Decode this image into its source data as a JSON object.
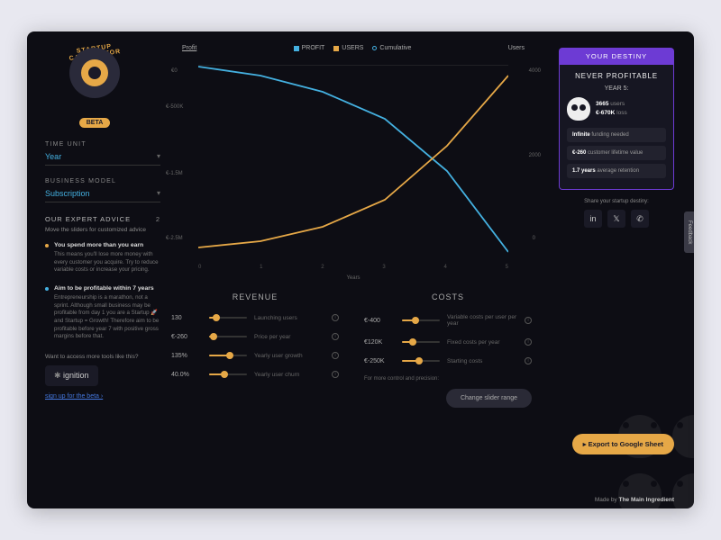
{
  "logo": {
    "title": "STARTUP CALCULATOR",
    "badge": "BETA"
  },
  "sidebar": {
    "time_unit_label": "TIME UNIT",
    "time_unit_value": "Year",
    "model_label": "BUSINESS MODEL",
    "model_value": "Subscription",
    "advice_header": "OUR EXPERT ADVICE",
    "advice_count": "2",
    "advice_sub": "Move the sliders for customized advice",
    "advice": [
      {
        "title": "You spend more than you earn",
        "body": "This means you'll lose more money with every customer you acquire. Try to reduce variable costs or increase your pricing.",
        "color": "orange"
      },
      {
        "title": "Aim to be profitable within 7 years",
        "body": "Entrepreneurship is a marathon, not a sprint. Although small business may be profitable from day 1 you are a Startup 🚀 and Startup = Growth! Therefore aim to be profitable before year 7 with positive gross margins before that.",
        "color": "blue"
      }
    ],
    "tools_label": "Want to access more tools like this?",
    "ignition": "ignition",
    "signup": "sign up for the beta ›"
  },
  "chart": {
    "left_axis": "Profit",
    "right_axis": "Users",
    "legend": [
      {
        "label": "PROFIT"
      },
      {
        "label": "USERS"
      },
      {
        "label": "Cumulative"
      }
    ],
    "x_label": "Years",
    "ticks": [
      "0",
      "1",
      "2",
      "3",
      "4",
      "5"
    ],
    "y_left": [
      "€0",
      "€-500K",
      "€-1.5M",
      "€-2.5M"
    ],
    "y_right": [
      "4000",
      "2000",
      "0"
    ]
  },
  "chart_data": {
    "type": "line",
    "x": [
      0,
      1,
      2,
      3,
      4,
      5
    ],
    "xlabel": "Years",
    "y_left_label": "Profit",
    "y_left_range": [
      -2500000,
      0
    ],
    "y_right_label": "Users",
    "y_right_range": [
      0,
      4000
    ],
    "series": [
      {
        "name": "PROFIT",
        "axis": "left",
        "values": [
          -13000,
          -140000,
          -350000,
          -720000,
          -1450000,
          -2550000
        ],
        "color": "#44b0e0"
      },
      {
        "name": "USERS",
        "axis": "right",
        "values": [
          130,
          280,
          600,
          1200,
          2200,
          3665
        ],
        "color": "#e6a847"
      }
    ],
    "cumulative_shown": true
  },
  "revenue": {
    "title": "REVENUE",
    "rows": [
      {
        "value": "130",
        "label": "Launching users",
        "fill": 20
      },
      {
        "value": "€-260",
        "label": "Price per year",
        "fill": 12
      },
      {
        "value": "135%",
        "label": "Yearly user growth",
        "fill": 55
      },
      {
        "value": "40.0%",
        "label": "Yearly user churn",
        "fill": 40
      }
    ]
  },
  "costs": {
    "title": "COSTS",
    "rows": [
      {
        "value": "€-400",
        "label": "Variable costs per user per year",
        "fill": 35
      },
      {
        "value": "€120K",
        "label": "Fixed costs per year",
        "fill": 28
      },
      {
        "value": "€-250K",
        "label": "Starting costs",
        "fill": 45
      }
    ],
    "more_control": "For more control and precision:",
    "change_range": "Change slider range"
  },
  "destiny": {
    "header": "YOUR DESTINY",
    "never": "NEVER PROFITABLE",
    "year": "YEAR 5:",
    "users_num": "3665",
    "users_lbl": "users",
    "loss_num": "€-670K",
    "loss_lbl": "loss",
    "pills": [
      {
        "b": "Infinite",
        "t": " funding needed"
      },
      {
        "b": "€-260",
        "t": " customer lifetime value"
      },
      {
        "b": "1.7 years",
        "t": " average retention"
      }
    ],
    "share_label": "Share your startup destiny:"
  },
  "export_label": "Export to Google Sheet",
  "footer_prefix": "Made by ",
  "footer_brand": "The Main Ingredient",
  "feedback": "Feedback"
}
